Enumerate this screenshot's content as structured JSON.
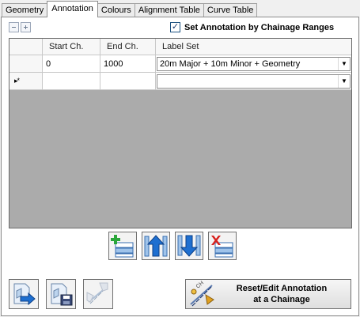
{
  "tabs": [
    {
      "label": "Geometry",
      "active": false
    },
    {
      "label": "Annotation",
      "active": true
    },
    {
      "label": "Colours",
      "active": false
    },
    {
      "label": "Alignment Table",
      "active": false
    },
    {
      "label": "Curve Table",
      "active": false
    }
  ],
  "set_annotation": {
    "label": "Set Annotation by Chainage Ranges",
    "checked": true
  },
  "grid": {
    "columns": [
      "Start Ch.",
      "End Ch.",
      "Label Set"
    ],
    "rows": [
      {
        "start": "0",
        "end": "1000",
        "label_set": "20m Major + 10m Minor + Geometry"
      }
    ],
    "new_row_marker": "▸*"
  },
  "reset_button": {
    "line1": "Reset/Edit Annotation",
    "line2": "at a Chainage"
  },
  "colors": {
    "grid_bg": "#ababab",
    "arrow_blue": "#1e6fd0",
    "add_green": "#2aa63a",
    "delete_red": "#d8201c"
  },
  "icons": {
    "collapse": "collapse-all-icon",
    "expand": "expand-all-icon",
    "add_row": "add-row-icon",
    "move_up": "move-up-icon",
    "move_down": "move-down-icon",
    "delete_row": "delete-row-icon",
    "export": "export-icon",
    "save": "save-icon",
    "edit_disabled": "edit-settings-icon",
    "reset": "reset-chainage-icon"
  }
}
